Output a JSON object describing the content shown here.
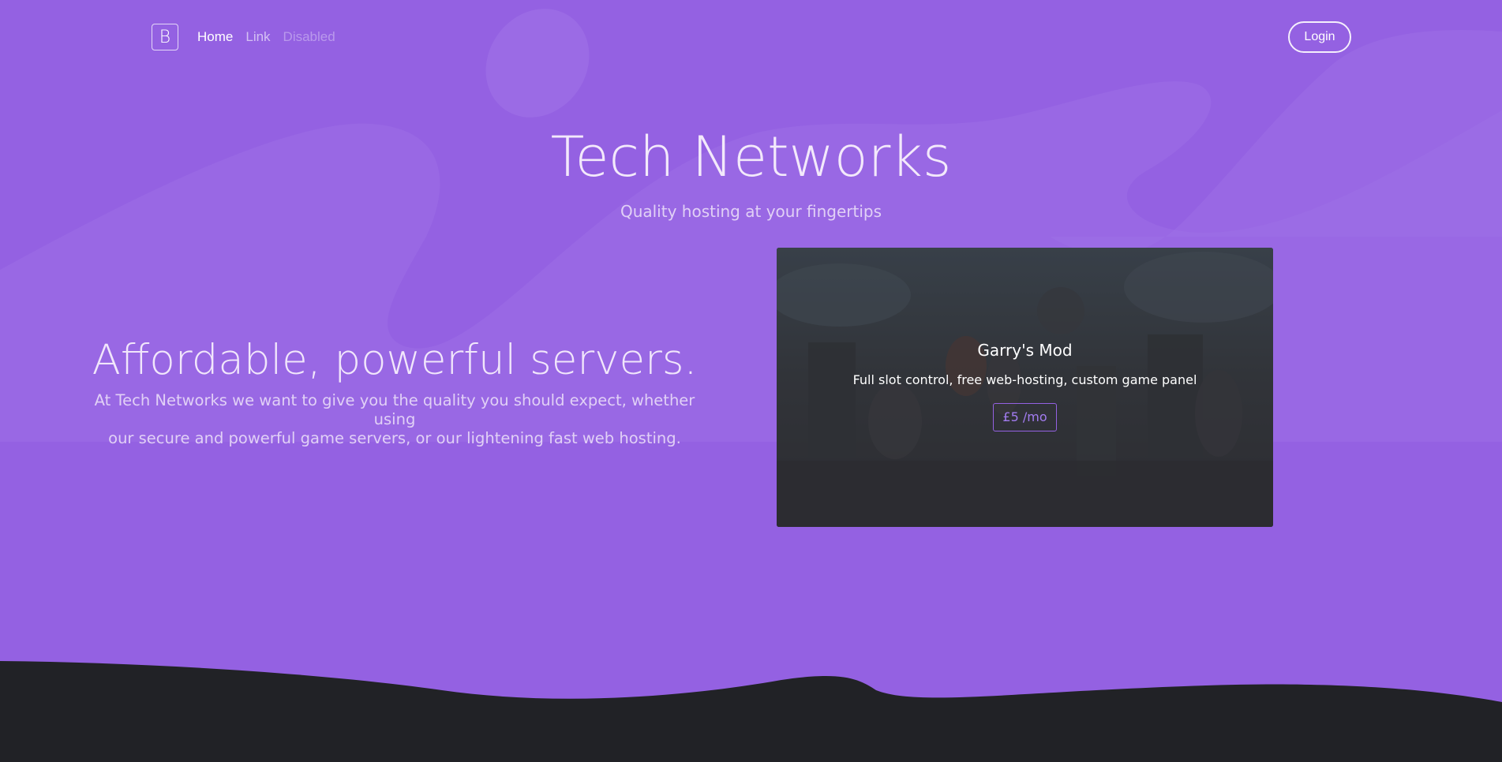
{
  "nav": {
    "brand": "B",
    "links": [
      {
        "label": "Home",
        "state": "active"
      },
      {
        "label": "Link",
        "state": "normal"
      },
      {
        "label": "Disabled",
        "state": "disabled"
      }
    ],
    "login_label": "Login"
  },
  "hero": {
    "title": "Tech Networks",
    "subtitle": "Quality hosting at your fingertips"
  },
  "feature": {
    "title": "Affordable, powerful servers.",
    "line1": "At Tech Networks we want to give you the quality you should expect, whether using",
    "line2": "our secure and powerful game servers, or our lightening fast web hosting."
  },
  "card": {
    "title": "Garry's Mod",
    "text": "Full slot control, free web-hosting, custom game panel",
    "button": "£5 /mo"
  },
  "colors": {
    "background": "#9461e2",
    "footer": "#212226",
    "accent": "#9461e2"
  }
}
